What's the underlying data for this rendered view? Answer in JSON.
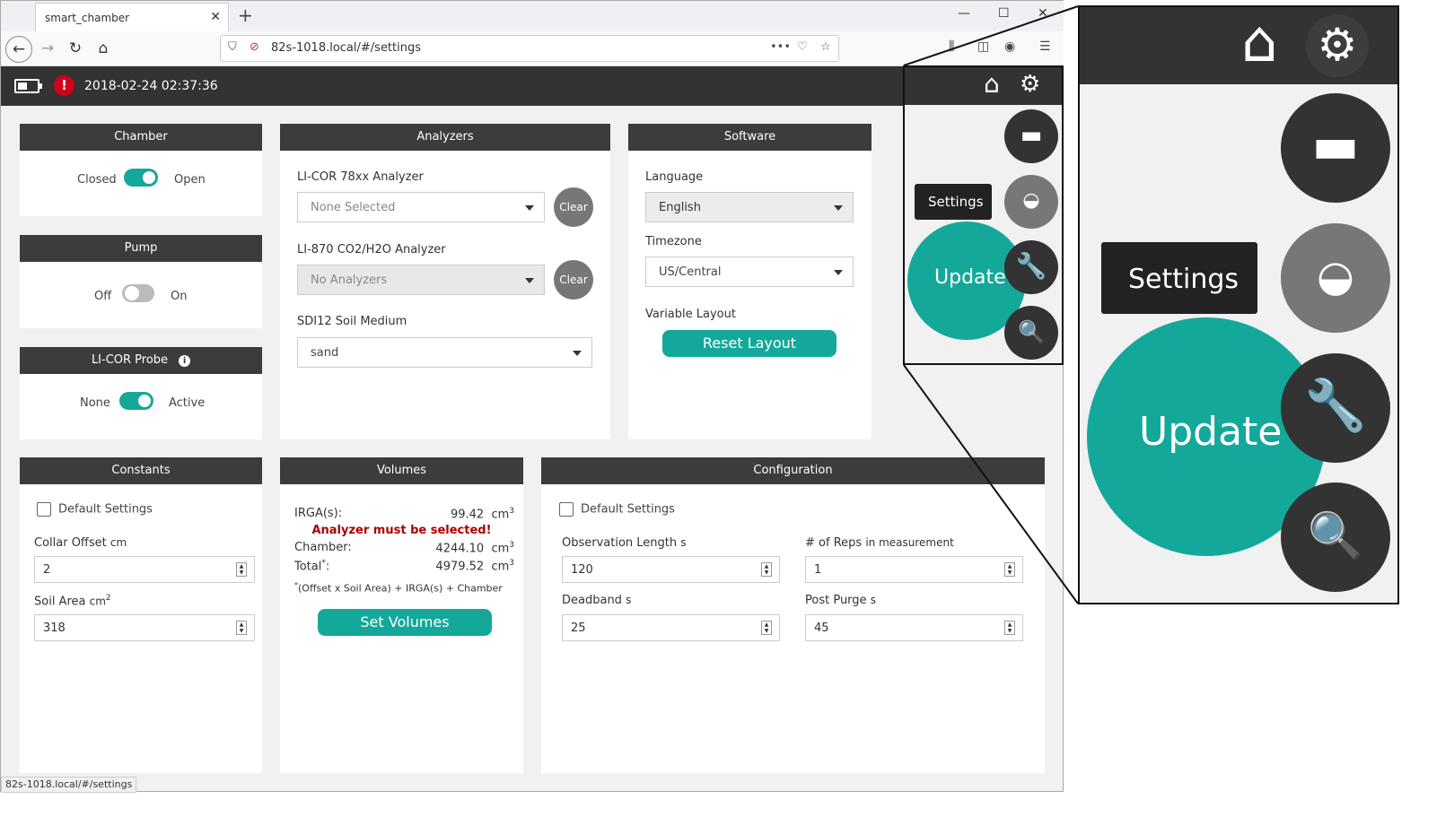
{
  "browser": {
    "tab_title": "smart_chamber",
    "tab_close": "✕",
    "new_tab": "+",
    "url": "82s-1018.local/#/settings",
    "status_url": "82s-1018.local/#/settings"
  },
  "appbar": {
    "datetime": "2018-02-24 02:37:36",
    "alert_symbol": "!"
  },
  "chamber": {
    "title": "Chamber",
    "left_label": "Closed",
    "right_label": "Open",
    "state": "open"
  },
  "pump": {
    "title": "Pump",
    "left_label": "Off",
    "right_label": "On",
    "state": "off"
  },
  "probe": {
    "title": "LI-COR Probe",
    "info": "i",
    "left_label": "None",
    "right_label": "Active",
    "state": "active"
  },
  "analyzers": {
    "title": "Analyzers",
    "licor78_label": "LI-COR 78xx Analyzer",
    "licor78_value": "None Selected",
    "li870_label": "LI-870 CO2/H2O Analyzer",
    "li870_value": "No Analyzers",
    "clear_label": "Clear",
    "soil_label": "SDI12 Soil Medium",
    "soil_value": "sand"
  },
  "software": {
    "title": "Software",
    "language_label": "Language",
    "language_value": "English",
    "timezone_label": "Timezone",
    "timezone_value": "US/Central",
    "layout_label": "Variable Layout",
    "reset_label": "Reset Layout"
  },
  "constants": {
    "title": "Constants",
    "default_label": "Default Settings",
    "collar_label": "Collar Offset",
    "collar_unit": "cm",
    "collar_value": "2",
    "area_label": "Soil Area",
    "area_unit": "cm",
    "area_sup": "2",
    "area_value": "318"
  },
  "volumes": {
    "title": "Volumes",
    "irga_label": "IRGA(s):",
    "irga_value": "99.42",
    "unit": "cm",
    "unit_sup": "3",
    "warning": "Analyzer must be selected!",
    "chamber_label": "Chamber:",
    "chamber_value": "4244.10",
    "total_label": "Total",
    "total_sup": "*",
    "total_colon": ":",
    "total_value": "4979.52",
    "footnote_sup": "*",
    "footnote": "(Offset x Soil Area) + IRGA(s) + Chamber",
    "set_label": "Set Volumes"
  },
  "configuration": {
    "title": "Configuration",
    "default_label": "Default Settings",
    "obs_label": "Observation Length",
    "obs_unit": "s",
    "obs_value": "120",
    "reps_label": "# of Reps",
    "reps_unit": "in measurement",
    "reps_value": "1",
    "deadband_label": "Deadband",
    "deadband_unit": "s",
    "deadband_value": "25",
    "purge_label": "Post Purge",
    "purge_unit": "s",
    "purge_value": "45"
  },
  "fab_menu": {
    "tooltip": "Settings",
    "update_label": "Update"
  },
  "colors": {
    "teal": "#14a89a",
    "dark": "#333333",
    "alert": "#d0021b"
  }
}
